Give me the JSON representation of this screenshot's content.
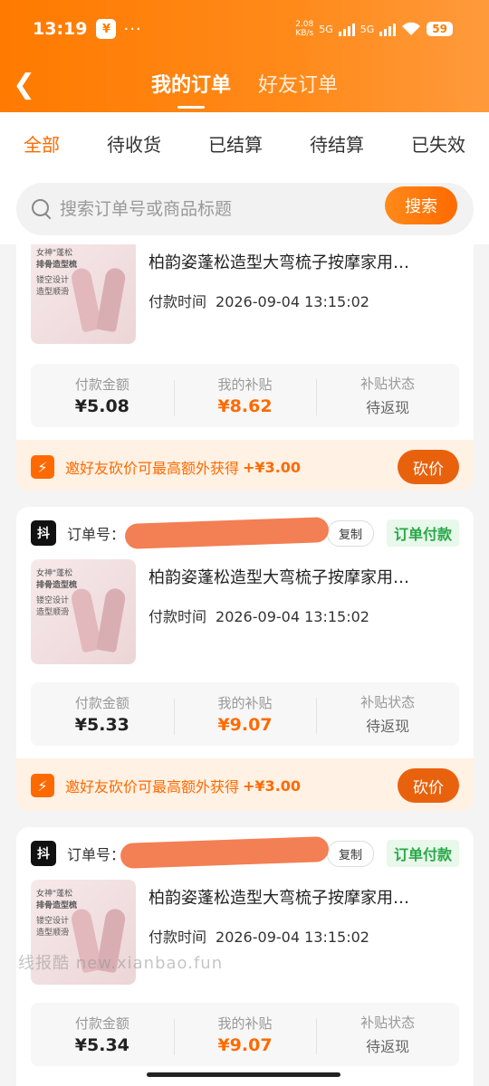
{
  "status_bar": {
    "time": "13:19",
    "app_icon": "¥",
    "more": "···",
    "net_speed_value": "2.08",
    "net_speed_unit": "KB/s",
    "sig1": "5G",
    "sig2": "5G",
    "battery": "59"
  },
  "header": {
    "back": "❮",
    "tabs": [
      {
        "label": "我的订单",
        "active": true
      },
      {
        "label": "好友订单",
        "active": false
      }
    ]
  },
  "filters": [
    "全部",
    "待收货",
    "已结算",
    "待结算",
    "已失效"
  ],
  "search": {
    "placeholder": "搜索订单号或商品标题",
    "button": "搜索"
  },
  "labels": {
    "order_no": "订单号：",
    "copy": "复制",
    "status": "订单付款",
    "pay_time_label": "付款时间",
    "pay_amount": "付款金额",
    "my_subsidy": "我的补贴",
    "subsidy_status": "补贴状态",
    "invite_text": "邀好友砍价可最高额外获得",
    "bargain": "砍价",
    "platform": "抖",
    "thumb_line1": "女神\"蓬松",
    "thumb_line2": "排骨造型梳",
    "thumb_line3": "镂空设计",
    "thumb_line4": "造型顺滑"
  },
  "orders": [
    {
      "title": "柏韵姿蓬松造型大弯梳子按摩家用…",
      "pay_time": "2026-09-04 13:15:02",
      "amount": "¥5.08",
      "subsidy": "¥8.62",
      "subsidy_status": "待返现",
      "extra": "+¥3.00"
    },
    {
      "title": "柏韵姿蓬松造型大弯梳子按摩家用…",
      "pay_time": "2026-09-04 13:15:02",
      "amount": "¥5.33",
      "subsidy": "¥9.07",
      "subsidy_status": "待返现",
      "extra": "+¥3.00"
    },
    {
      "title": "柏韵姿蓬松造型大弯梳子按摩家用…",
      "pay_time": "2026-09-04 13:15:02",
      "amount": "¥5.34",
      "subsidy": "¥9.07",
      "subsidy_status": "待返现"
    }
  ],
  "watermark": "线报酷 new.xianbao.fun"
}
